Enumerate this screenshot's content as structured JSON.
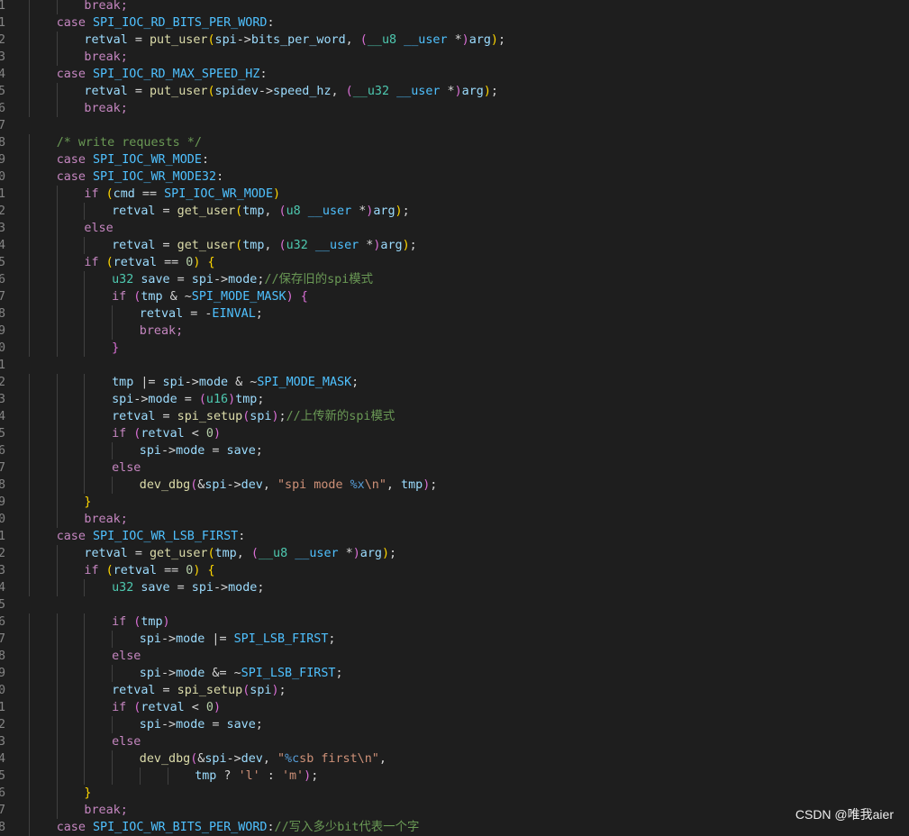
{
  "watermark": "CSDN @唯我aier",
  "lines": [
    {
      "n": "1",
      "i": 2,
      "t": [
        [
          "break;",
          "kw"
        ]
      ]
    },
    {
      "n": "1",
      "i": 1,
      "t": [
        [
          "case ",
          "kw"
        ],
        [
          "SPI_IOC_RD_BITS_PER_WORD",
          "mc"
        ],
        [
          ":",
          "op"
        ]
      ]
    },
    {
      "n": "2",
      "i": 2,
      "t": [
        [
          "retval",
          "vr"
        ],
        [
          " = ",
          "op"
        ],
        [
          "put_user",
          "fn"
        ],
        [
          "(",
          "p1"
        ],
        [
          "spi",
          "vr"
        ],
        [
          "->",
          "op"
        ],
        [
          "bits_per_word",
          "vr"
        ],
        [
          ", ",
          "op"
        ],
        [
          "(",
          "p2"
        ],
        [
          "__u8",
          "ty"
        ],
        [
          " ",
          "op"
        ],
        [
          "__user",
          "mc"
        ],
        [
          " *",
          "op"
        ],
        [
          ")",
          "p2"
        ],
        [
          "arg",
          "vr"
        ],
        [
          ")",
          "p1"
        ],
        [
          ";",
          "op"
        ]
      ]
    },
    {
      "n": "3",
      "i": 2,
      "t": [
        [
          "break;",
          "kw"
        ]
      ]
    },
    {
      "n": "4",
      "i": 1,
      "t": [
        [
          "case ",
          "kw"
        ],
        [
          "SPI_IOC_RD_MAX_SPEED_HZ",
          "mc"
        ],
        [
          ":",
          "op"
        ]
      ]
    },
    {
      "n": "5",
      "i": 2,
      "t": [
        [
          "retval",
          "vr"
        ],
        [
          " = ",
          "op"
        ],
        [
          "put_user",
          "fn"
        ],
        [
          "(",
          "p1"
        ],
        [
          "spidev",
          "vr"
        ],
        [
          "->",
          "op"
        ],
        [
          "speed_hz",
          "vr"
        ],
        [
          ", ",
          "op"
        ],
        [
          "(",
          "p2"
        ],
        [
          "__u32",
          "ty"
        ],
        [
          " ",
          "op"
        ],
        [
          "__user",
          "mc"
        ],
        [
          " *",
          "op"
        ],
        [
          ")",
          "p2"
        ],
        [
          "arg",
          "vr"
        ],
        [
          ")",
          "p1"
        ],
        [
          ";",
          "op"
        ]
      ]
    },
    {
      "n": "6",
      "i": 2,
      "t": [
        [
          "break;",
          "kw"
        ]
      ]
    },
    {
      "n": "7",
      "i": 0,
      "t": []
    },
    {
      "n": "8",
      "i": 1,
      "t": [
        [
          "/* write requests */",
          "cm"
        ]
      ]
    },
    {
      "n": "9",
      "i": 1,
      "t": [
        [
          "case ",
          "kw"
        ],
        [
          "SPI_IOC_WR_MODE",
          "mc"
        ],
        [
          ":",
          "op"
        ]
      ]
    },
    {
      "n": "0",
      "i": 1,
      "t": [
        [
          "case ",
          "kw"
        ],
        [
          "SPI_IOC_WR_MODE32",
          "mc"
        ],
        [
          ":",
          "op"
        ]
      ]
    },
    {
      "n": "1",
      "i": 2,
      "t": [
        [
          "if ",
          "kw"
        ],
        [
          "(",
          "p1"
        ],
        [
          "cmd",
          "vr"
        ],
        [
          " == ",
          "op"
        ],
        [
          "SPI_IOC_WR_MODE",
          "mc"
        ],
        [
          ")",
          "p1"
        ]
      ]
    },
    {
      "n": "2",
      "i": 3,
      "t": [
        [
          "retval",
          "vr"
        ],
        [
          " = ",
          "op"
        ],
        [
          "get_user",
          "fn"
        ],
        [
          "(",
          "p1"
        ],
        [
          "tmp",
          "vr"
        ],
        [
          ", ",
          "op"
        ],
        [
          "(",
          "p2"
        ],
        [
          "u8",
          "ty"
        ],
        [
          " ",
          "op"
        ],
        [
          "__user",
          "mc"
        ],
        [
          " *",
          "op"
        ],
        [
          ")",
          "p2"
        ],
        [
          "arg",
          "vr"
        ],
        [
          ")",
          "p1"
        ],
        [
          ";",
          "op"
        ]
      ]
    },
    {
      "n": "3",
      "i": 2,
      "t": [
        [
          "else",
          "kw"
        ]
      ]
    },
    {
      "n": "4",
      "i": 3,
      "t": [
        [
          "retval",
          "vr"
        ],
        [
          " = ",
          "op"
        ],
        [
          "get_user",
          "fn"
        ],
        [
          "(",
          "p1"
        ],
        [
          "tmp",
          "vr"
        ],
        [
          ", ",
          "op"
        ],
        [
          "(",
          "p2"
        ],
        [
          "u32",
          "ty"
        ],
        [
          " ",
          "op"
        ],
        [
          "__user",
          "mc"
        ],
        [
          " *",
          "op"
        ],
        [
          ")",
          "p2"
        ],
        [
          "arg",
          "vr"
        ],
        [
          ")",
          "p1"
        ],
        [
          ";",
          "op"
        ]
      ]
    },
    {
      "n": "5",
      "i": 2,
      "t": [
        [
          "if ",
          "kw"
        ],
        [
          "(",
          "p1"
        ],
        [
          "retval",
          "vr"
        ],
        [
          " == ",
          "op"
        ],
        [
          "0",
          "nm"
        ],
        [
          ") ",
          "p1"
        ],
        [
          "{",
          "p1"
        ]
      ]
    },
    {
      "n": "6",
      "i": 3,
      "t": [
        [
          "u32",
          "ty"
        ],
        [
          " ",
          "op"
        ],
        [
          "save",
          "vr"
        ],
        [
          " = ",
          "op"
        ],
        [
          "spi",
          "vr"
        ],
        [
          "->",
          "op"
        ],
        [
          "mode",
          "vr"
        ],
        [
          ";",
          "op"
        ],
        [
          "//保存旧的spi模式",
          "cm"
        ]
      ]
    },
    {
      "n": "7",
      "i": 3,
      "t": [
        [
          "if ",
          "kw"
        ],
        [
          "(",
          "p2"
        ],
        [
          "tmp",
          "vr"
        ],
        [
          " & ~",
          "op"
        ],
        [
          "SPI_MODE_MASK",
          "mc"
        ],
        [
          ") ",
          "p2"
        ],
        [
          "{",
          "p2"
        ]
      ]
    },
    {
      "n": "8",
      "i": 4,
      "t": [
        [
          "retval",
          "vr"
        ],
        [
          " = -",
          "op"
        ],
        [
          "EINVAL",
          "mc"
        ],
        [
          ";",
          "op"
        ]
      ]
    },
    {
      "n": "9",
      "i": 4,
      "t": [
        [
          "break;",
          "kw"
        ]
      ]
    },
    {
      "n": "0",
      "i": 3,
      "t": [
        [
          "}",
          "p2"
        ]
      ]
    },
    {
      "n": "1",
      "i": 0,
      "t": []
    },
    {
      "n": "2",
      "i": 3,
      "t": [
        [
          "tmp",
          "vr"
        ],
        [
          " |= ",
          "op"
        ],
        [
          "spi",
          "vr"
        ],
        [
          "->",
          "op"
        ],
        [
          "mode",
          "vr"
        ],
        [
          " & ~",
          "op"
        ],
        [
          "SPI_MODE_MASK",
          "mc"
        ],
        [
          ";",
          "op"
        ]
      ]
    },
    {
      "n": "3",
      "i": 3,
      "t": [
        [
          "spi",
          "vr"
        ],
        [
          "->",
          "op"
        ],
        [
          "mode",
          "vr"
        ],
        [
          " = ",
          "op"
        ],
        [
          "(",
          "p2"
        ],
        [
          "u16",
          "ty"
        ],
        [
          ")",
          "p2"
        ],
        [
          "tmp",
          "vr"
        ],
        [
          ";",
          "op"
        ]
      ]
    },
    {
      "n": "4",
      "i": 3,
      "t": [
        [
          "retval",
          "vr"
        ],
        [
          " = ",
          "op"
        ],
        [
          "spi_setup",
          "fn"
        ],
        [
          "(",
          "p2"
        ],
        [
          "spi",
          "vr"
        ],
        [
          ")",
          "p2"
        ],
        [
          ";",
          "op"
        ],
        [
          "//上传新的spi模式",
          "cm"
        ]
      ]
    },
    {
      "n": "5",
      "i": 3,
      "t": [
        [
          "if ",
          "kw"
        ],
        [
          "(",
          "p2"
        ],
        [
          "retval",
          "vr"
        ],
        [
          " < ",
          "op"
        ],
        [
          "0",
          "nm"
        ],
        [
          ")",
          "p2"
        ]
      ]
    },
    {
      "n": "6",
      "i": 4,
      "t": [
        [
          "spi",
          "vr"
        ],
        [
          "->",
          "op"
        ],
        [
          "mode",
          "vr"
        ],
        [
          " = ",
          "op"
        ],
        [
          "save",
          "vr"
        ],
        [
          ";",
          "op"
        ]
      ]
    },
    {
      "n": "7",
      "i": 3,
      "t": [
        [
          "else",
          "kw"
        ]
      ]
    },
    {
      "n": "8",
      "i": 4,
      "t": [
        [
          "dev_dbg",
          "fn"
        ],
        [
          "(",
          "p2"
        ],
        [
          "&",
          "op"
        ],
        [
          "spi",
          "vr"
        ],
        [
          "->",
          "op"
        ],
        [
          "dev",
          "vr"
        ],
        [
          ", ",
          "op"
        ],
        [
          "\"spi mode ",
          "st"
        ],
        [
          "%x",
          "ct"
        ],
        [
          "\\n",
          "st"
        ],
        [
          "\"",
          "st"
        ],
        [
          ", ",
          "op"
        ],
        [
          "tmp",
          "vr"
        ],
        [
          ")",
          "p2"
        ],
        [
          ";",
          "op"
        ]
      ]
    },
    {
      "n": "9",
      "i": 2,
      "t": [
        [
          "}",
          "p1"
        ]
      ]
    },
    {
      "n": "0",
      "i": 2,
      "t": [
        [
          "break;",
          "kw"
        ]
      ]
    },
    {
      "n": "1",
      "i": 1,
      "t": [
        [
          "case ",
          "kw"
        ],
        [
          "SPI_IOC_WR_LSB_FIRST",
          "mc"
        ],
        [
          ":",
          "op"
        ]
      ]
    },
    {
      "n": "2",
      "i": 2,
      "t": [
        [
          "retval",
          "vr"
        ],
        [
          " = ",
          "op"
        ],
        [
          "get_user",
          "fn"
        ],
        [
          "(",
          "p1"
        ],
        [
          "tmp",
          "vr"
        ],
        [
          ", ",
          "op"
        ],
        [
          "(",
          "p2"
        ],
        [
          "__u8",
          "ty"
        ],
        [
          " ",
          "op"
        ],
        [
          "__user",
          "mc"
        ],
        [
          " *",
          "op"
        ],
        [
          ")",
          "p2"
        ],
        [
          "arg",
          "vr"
        ],
        [
          ")",
          "p1"
        ],
        [
          ";",
          "op"
        ]
      ]
    },
    {
      "n": "3",
      "i": 2,
      "t": [
        [
          "if ",
          "kw"
        ],
        [
          "(",
          "p1"
        ],
        [
          "retval",
          "vr"
        ],
        [
          " == ",
          "op"
        ],
        [
          "0",
          "nm"
        ],
        [
          ") ",
          "p1"
        ],
        [
          "{",
          "p1"
        ]
      ]
    },
    {
      "n": "4",
      "i": 3,
      "t": [
        [
          "u32",
          "ty"
        ],
        [
          " ",
          "op"
        ],
        [
          "save",
          "vr"
        ],
        [
          " = ",
          "op"
        ],
        [
          "spi",
          "vr"
        ],
        [
          "->",
          "op"
        ],
        [
          "mode",
          "vr"
        ],
        [
          ";",
          "op"
        ]
      ]
    },
    {
      "n": "5",
      "i": 0,
      "t": []
    },
    {
      "n": "6",
      "i": 3,
      "t": [
        [
          "if ",
          "kw"
        ],
        [
          "(",
          "p2"
        ],
        [
          "tmp",
          "vr"
        ],
        [
          ")",
          "p2"
        ]
      ]
    },
    {
      "n": "7",
      "i": 4,
      "t": [
        [
          "spi",
          "vr"
        ],
        [
          "->",
          "op"
        ],
        [
          "mode",
          "vr"
        ],
        [
          " |= ",
          "op"
        ],
        [
          "SPI_LSB_FIRST",
          "mc"
        ],
        [
          ";",
          "op"
        ]
      ]
    },
    {
      "n": "8",
      "i": 3,
      "t": [
        [
          "else",
          "kw"
        ]
      ]
    },
    {
      "n": "9",
      "i": 4,
      "t": [
        [
          "spi",
          "vr"
        ],
        [
          "->",
          "op"
        ],
        [
          "mode",
          "vr"
        ],
        [
          " &= ~",
          "op"
        ],
        [
          "SPI_LSB_FIRST",
          "mc"
        ],
        [
          ";",
          "op"
        ]
      ]
    },
    {
      "n": "0",
      "i": 3,
      "t": [
        [
          "retval",
          "vr"
        ],
        [
          " = ",
          "op"
        ],
        [
          "spi_setup",
          "fn"
        ],
        [
          "(",
          "p2"
        ],
        [
          "spi",
          "vr"
        ],
        [
          ")",
          "p2"
        ],
        [
          ";",
          "op"
        ]
      ]
    },
    {
      "n": "1",
      "i": 3,
      "t": [
        [
          "if ",
          "kw"
        ],
        [
          "(",
          "p2"
        ],
        [
          "retval",
          "vr"
        ],
        [
          " < ",
          "op"
        ],
        [
          "0",
          "nm"
        ],
        [
          ")",
          "p2"
        ]
      ]
    },
    {
      "n": "2",
      "i": 4,
      "t": [
        [
          "spi",
          "vr"
        ],
        [
          "->",
          "op"
        ],
        [
          "mode",
          "vr"
        ],
        [
          " = ",
          "op"
        ],
        [
          "save",
          "vr"
        ],
        [
          ";",
          "op"
        ]
      ]
    },
    {
      "n": "3",
      "i": 3,
      "t": [
        [
          "else",
          "kw"
        ]
      ]
    },
    {
      "n": "4",
      "i": 4,
      "t": [
        [
          "dev_dbg",
          "fn"
        ],
        [
          "(",
          "p2"
        ],
        [
          "&",
          "op"
        ],
        [
          "spi",
          "vr"
        ],
        [
          "->",
          "op"
        ],
        [
          "dev",
          "vr"
        ],
        [
          ", ",
          "op"
        ],
        [
          "\"",
          "st"
        ],
        [
          "%c",
          "ct"
        ],
        [
          "sb first",
          "st"
        ],
        [
          "\\n",
          "st"
        ],
        [
          "\"",
          "st"
        ],
        [
          ",",
          "op"
        ]
      ]
    },
    {
      "n": "5",
      "i": 6,
      "t": [
        [
          "tmp",
          "vr"
        ],
        [
          " ? ",
          "op"
        ],
        [
          "'l'",
          "st"
        ],
        [
          " : ",
          "op"
        ],
        [
          "'m'",
          "st"
        ],
        [
          ")",
          "p2"
        ],
        [
          ";",
          "op"
        ]
      ]
    },
    {
      "n": "6",
      "i": 2,
      "t": [
        [
          "}",
          "p1"
        ]
      ]
    },
    {
      "n": "7",
      "i": 2,
      "t": [
        [
          "break;",
          "kw"
        ]
      ]
    },
    {
      "n": "8",
      "i": 1,
      "t": [
        [
          "case ",
          "kw"
        ],
        [
          "SPI_IOC_WR_BITS_PER_WORD",
          "mc"
        ],
        [
          ":",
          "op"
        ],
        [
          "//写入多少bit代表一个字",
          "cm"
        ]
      ]
    }
  ]
}
